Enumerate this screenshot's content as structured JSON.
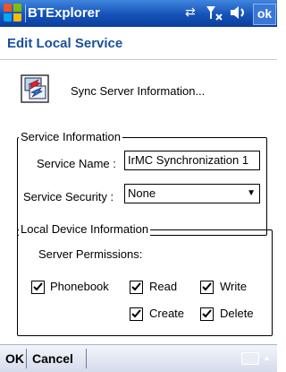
{
  "titlebar": {
    "app_title": "BTExplorer",
    "ok_label": "ok",
    "tray_icons": [
      "connectivity-icon",
      "signal-off-icon",
      "volume-icon"
    ]
  },
  "header": {
    "title": "Edit Local Service"
  },
  "sync": {
    "label": "Sync Server Information...",
    "icon": "sync-icon"
  },
  "service_info": {
    "legend": "Service Information",
    "name_label": "Service Name :",
    "name_value": "IrMC Synchronization 1",
    "security_label": "Service Security :",
    "security_value": "None"
  },
  "local_device": {
    "legend": "Local Device Information",
    "permissions_label": "Server Permissions:",
    "checkboxes": {
      "phonebook": {
        "label": "Phonebook",
        "checked": true
      },
      "read": {
        "label": "Read",
        "checked": true
      },
      "write": {
        "label": "Write",
        "checked": true
      },
      "create": {
        "label": "Create",
        "checked": true
      },
      "delete": {
        "label": "Delete",
        "checked": true
      }
    }
  },
  "softkeys": {
    "left": "OK",
    "right": "Cancel"
  },
  "colors": {
    "titlebar": "#1552b8",
    "header_text": "#1a4f9e"
  }
}
